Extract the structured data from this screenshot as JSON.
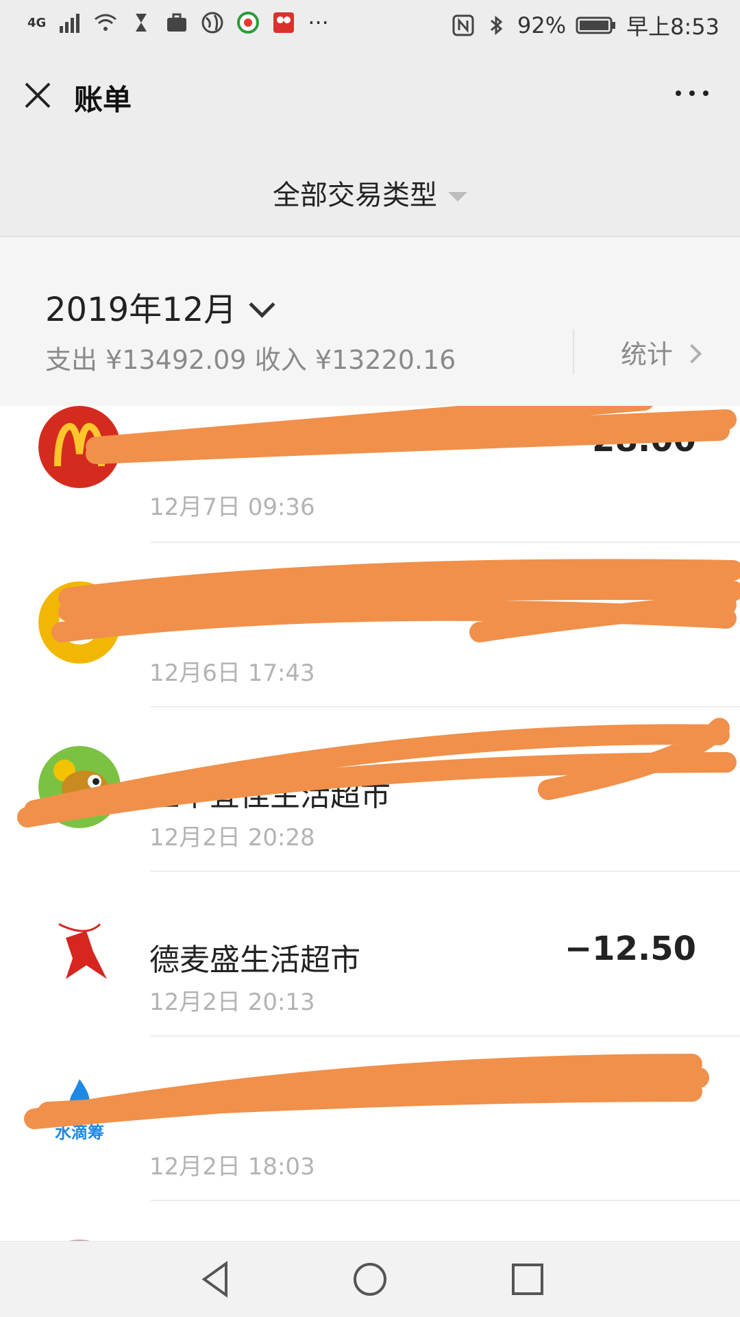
{
  "status_bar": {
    "network": "4G",
    "more": "···",
    "battery": "92%",
    "time": "早上8:53"
  },
  "header": {
    "title": "账单"
  },
  "filter": {
    "label": "全部交易类型"
  },
  "summary": {
    "month": "2019年12月",
    "expense_label": "支出",
    "expense_amount": "¥13492.09",
    "income_label": "收入",
    "income_amount": "¥13220.16",
    "stats_label": "统计"
  },
  "transactions": [
    {
      "merchant": "",
      "time": "12月7日 09:36",
      "amount": "28.00",
      "icon": "mcdonalds-logo",
      "redacted": true
    },
    {
      "merchant": "",
      "time": "12月6日 17:43",
      "amount": "",
      "icon": "yellow-coin-bag-logo",
      "redacted": true
    },
    {
      "merchant": "汇丰宜佳生活超市",
      "time": "12月2日 20:28",
      "amount": "",
      "icon": "frog-coin-logo",
      "redacted": true
    },
    {
      "merchant": "德麦盛生活超市",
      "time": "12月2日 20:13",
      "amount": "−12.50",
      "icon": "archer-logo",
      "redacted": false
    },
    {
      "merchant": "",
      "time": "12月2日 18:03",
      "amount": "",
      "icon": "shuidichou-logo",
      "icon_text": "水滴筹",
      "redacted": true
    },
    {
      "merchant": "",
      "time": "",
      "amount": "",
      "icon": "avatar-photo",
      "redacted": false
    }
  ],
  "colors": {
    "background": "#ededed",
    "text_secondary": "#8a8a8a",
    "redaction": "#f0904a",
    "mcdonalds_red": "#d52b1e",
    "mcdonalds_yellow": "#ffc72c"
  }
}
